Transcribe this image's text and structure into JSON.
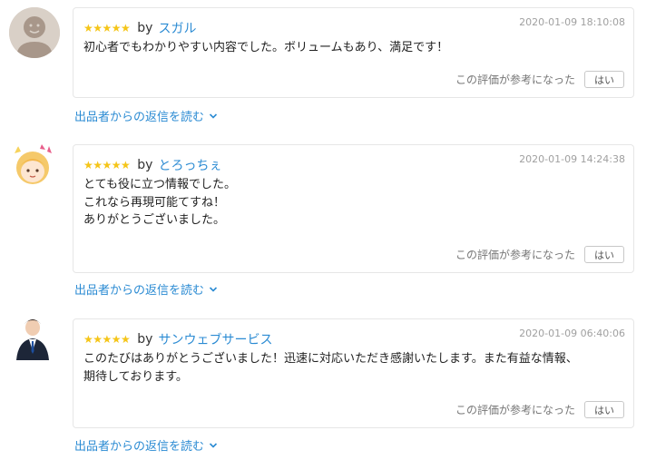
{
  "reviews": [
    {
      "rating_stars": "★★★★★",
      "rating": 5,
      "by": "by",
      "reviewer": "スガル",
      "date": "2020-01-09 18:10:08",
      "body": "初心者でもわかりやすい内容でした。ボリュームもあり、満足です！",
      "helpful_question": "この評価が参考になった",
      "helpful_yes": "はい",
      "reply_link": "出品者からの返信を読む"
    },
    {
      "rating_stars": "★★★★★",
      "rating": 5,
      "by": "by",
      "reviewer": "とろっちぇ",
      "date": "2020-01-09 14:24:38",
      "body": "とても役に立つ情報でした。\nこれなら再現可能てすね！\nありがとうございました。",
      "helpful_question": "この評価が参考になった",
      "helpful_yes": "はい",
      "reply_link": "出品者からの返信を読む"
    },
    {
      "rating_stars": "★★★★★",
      "rating": 5,
      "by": "by",
      "reviewer": "サンウェブサービス",
      "date": "2020-01-09 06:40:06",
      "body": "このたびはありがとうございました！迅速に対応いただき感謝いたします。また有益な情報、\n期待しております。",
      "helpful_question": "この評価が参考になった",
      "helpful_yes": "はい",
      "reply_link": "出品者からの返信を読む"
    }
  ],
  "colors": {
    "link": "#2b8bd3",
    "star": "#f5c518",
    "date": "#a0a0a0",
    "border": "#e6e6e6"
  },
  "icons": {
    "avatar_1": "default-user-avatar-icon",
    "avatar_2": "illustrated-girl-avatar",
    "avatar_3": "businessman-photo-avatar",
    "reply_chevron": "chevron-down-icon"
  }
}
